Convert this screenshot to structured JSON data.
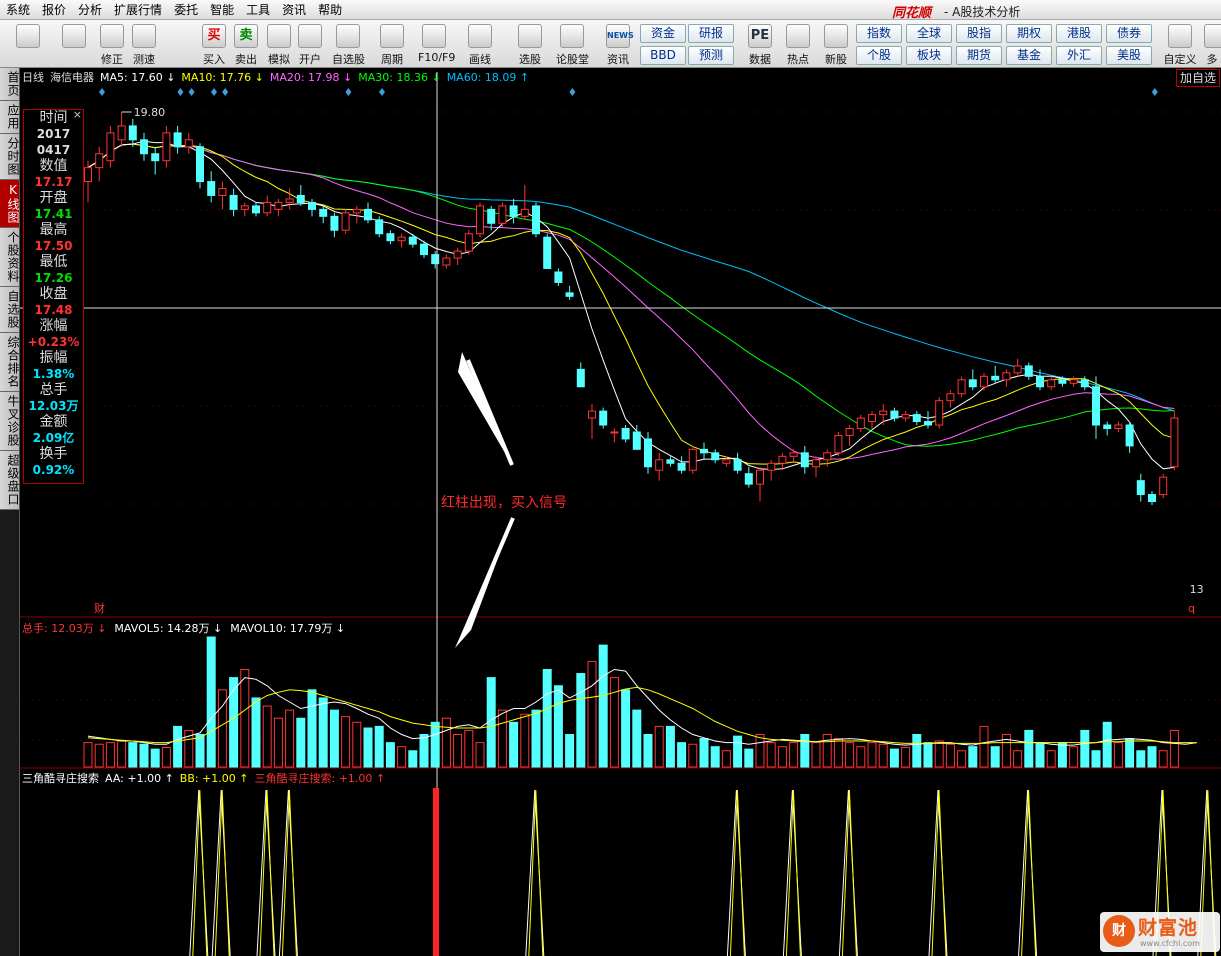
{
  "menu": [
    "系统",
    "报价",
    "分析",
    "扩展行情",
    "委托",
    "智能",
    "工具",
    "资讯",
    "帮助"
  ],
  "brand": "同花顺",
  "app_title": "- A股技术分析",
  "toolbar": {
    "items": [
      {
        "label": "",
        "icon": "color-grid-icon"
      },
      {
        "label": "",
        "icon": "back-arrow-icon"
      },
      {
        "label": "修正",
        "icon": "up-down-arrows-icon"
      },
      {
        "label": "测速",
        "icon": "clock-icon"
      },
      {
        "label": "买入",
        "icon": "buy-icon",
        "glyph": "买"
      },
      {
        "label": "卖出",
        "icon": "sell-icon",
        "glyph": "卖"
      },
      {
        "label": "模拟",
        "icon": "hammer-icon"
      },
      {
        "label": "开户",
        "icon": "lock-icon"
      },
      {
        "label": "自选股",
        "icon": "star-icon"
      },
      {
        "label": "周期",
        "icon": "period-icon"
      },
      {
        "label": "F10/F9",
        "icon": "f10-icon"
      },
      {
        "label": "画线",
        "icon": "pen-icon"
      },
      {
        "label": "选股",
        "icon": "monitor-icon"
      },
      {
        "label": "论股堂",
        "icon": "discuss-icon"
      },
      {
        "label": "资讯",
        "icon": "news-icon",
        "glyph": "NEWS"
      },
      {
        "label": "数据",
        "icon": "pe-icon",
        "glyph": "PE"
      },
      {
        "label": "热点",
        "icon": "hot-icon"
      },
      {
        "label": "新股",
        "icon": "ipo-icon"
      }
    ],
    "grid_buttons": [
      [
        "资金",
        "研报"
      ],
      [
        "BBD",
        "预测"
      ]
    ],
    "market_buttons": [
      [
        "指数",
        "全球",
        "股指",
        "期权",
        "港股",
        "债券"
      ],
      [
        "个股",
        "板块",
        "期货",
        "基金",
        "外汇",
        "美股"
      ]
    ],
    "right_label": "自定义",
    "more_label": "多"
  },
  "sidebar": [
    "首页",
    "应用",
    "分时图",
    "K线图",
    "个股资料",
    "自选股",
    "综合排名",
    "牛叉诊股",
    "超级盘口"
  ],
  "legend": {
    "period": "日线",
    "stock": "海信电器",
    "items": [
      {
        "text": "MA5: 17.60",
        "arrow": "↓",
        "color": "#ffffff"
      },
      {
        "text": "MA10: 17.76",
        "arrow": "↓",
        "color": "#ffff00"
      },
      {
        "text": "MA20: 17.98",
        "arrow": "↓",
        "color": "#ff66ff"
      },
      {
        "text": "MA30: 18.36",
        "arrow": "↓",
        "color": "#00ff00"
      },
      {
        "text": "MA60: 18.09",
        "arrow": "↑",
        "color": "#00bfff"
      }
    ]
  },
  "add_select": "加自选",
  "info": [
    {
      "k": "时间",
      "v": "2017",
      "color": "#dddddd"
    },
    {
      "k": "",
      "v": "0417",
      "color": "#dddddd"
    },
    {
      "k": "数值",
      "v": "17.17",
      "color": "#ff3333"
    },
    {
      "k": "开盘",
      "v": "17.41",
      "color": "#00dd00"
    },
    {
      "k": "最高",
      "v": "17.50",
      "color": "#ff3333"
    },
    {
      "k": "最低",
      "v": "17.26",
      "color": "#00dd00"
    },
    {
      "k": "收盘",
      "v": "17.48",
      "color": "#ff3333"
    },
    {
      "k": "涨幅",
      "v": "+0.23%",
      "color": "#ff3333"
    },
    {
      "k": "振幅",
      "v": "1.38%",
      "color": "#00e5ff"
    },
    {
      "k": "总手",
      "v": "12.03万",
      "color": "#00e5ff"
    },
    {
      "k": "金额",
      "v": "2.09亿",
      "color": "#00e5ff"
    },
    {
      "k": "换手",
      "v": "0.92%",
      "color": "#00e5ff"
    }
  ],
  "price_labels": {
    "high": "19.80",
    "low": "13",
    "q_marker": "q",
    "cai": "财"
  },
  "annotation": "红柱出现，买入信号",
  "volume_legend": [
    {
      "text": "总手: 12.03万",
      "arrow": "↓",
      "color": "#ff3333"
    },
    {
      "text": "MAVOL5: 14.28万",
      "arrow": "↓",
      "color": "#ffffff"
    },
    {
      "text": "MAVOL10: 17.79万",
      "arrow": "↓",
      "color": "#ffffff"
    }
  ],
  "indicator_legend": [
    {
      "text": "三角酷寻庄搜索",
      "arrow": "",
      "color": "#ffffff"
    },
    {
      "text": "AA: +1.00",
      "arrow": "↑",
      "color": "#ffffff"
    },
    {
      "text": "BB: +1.00",
      "arrow": "↑",
      "color": "#ffff00"
    },
    {
      "text": "三角酷寻庄搜索: +1.00",
      "arrow": "↑",
      "color": "#ff3333"
    }
  ],
  "watermark": {
    "logo": "财",
    "name": "财富池",
    "url": "www.cfchi.com"
  },
  "chart_data": {
    "type": "candlestick",
    "price_axis": [
      13,
      19.8
    ],
    "candles": [
      [
        18.8,
        19.1,
        18.5,
        19
      ],
      [
        19,
        19.3,
        18.8,
        19.2
      ],
      [
        19.1,
        19.6,
        19,
        19.5
      ],
      [
        19.4,
        19.8,
        19.3,
        19.6
      ],
      [
        19.6,
        19.7,
        19.3,
        19.4
      ],
      [
        19.4,
        19.5,
        19.1,
        19.2
      ],
      [
        19.2,
        19.3,
        18.9,
        19.1
      ],
      [
        19.1,
        19.6,
        19.0,
        19.5
      ],
      [
        19.5,
        19.6,
        19.2,
        19.3
      ],
      [
        19.3,
        19.5,
        19.2,
        19.4
      ],
      [
        19.3,
        19.35,
        18.7,
        18.8
      ],
      [
        18.8,
        18.95,
        18.5,
        18.6
      ],
      [
        18.6,
        18.8,
        18.4,
        18.7
      ],
      [
        18.6,
        18.7,
        18.3,
        18.4
      ],
      [
        18.4,
        18.5,
        18.3,
        18.45
      ],
      [
        18.45,
        18.5,
        18.3,
        18.35
      ],
      [
        18.35,
        18.6,
        18.3,
        18.5
      ],
      [
        18.4,
        18.55,
        18.3,
        18.5
      ],
      [
        18.5,
        18.7,
        18.4,
        18.55
      ],
      [
        18.6,
        18.75,
        18.45,
        18.5
      ],
      [
        18.5,
        18.55,
        18.3,
        18.4
      ],
      [
        18.4,
        18.45,
        18.2,
        18.3
      ],
      [
        18.3,
        18.35,
        18.0,
        18.1
      ],
      [
        18.1,
        18.4,
        18.05,
        18.35
      ],
      [
        18.35,
        18.45,
        18.2,
        18.4
      ],
      [
        18.4,
        18.5,
        18.2,
        18.25
      ],
      [
        18.25,
        18.3,
        18.0,
        18.05
      ],
      [
        18.05,
        18.1,
        17.9,
        17.95
      ],
      [
        17.95,
        18.05,
        17.85,
        18.0
      ],
      [
        18.0,
        18.05,
        17.85,
        17.9
      ],
      [
        17.9,
        17.95,
        17.7,
        17.75
      ],
      [
        17.75,
        17.8,
        17.55,
        17.62
      ],
      [
        17.6,
        17.75,
        17.55,
        17.7
      ],
      [
        17.7,
        17.85,
        17.6,
        17.8
      ],
      [
        17.8,
        18.1,
        17.75,
        18.05
      ],
      [
        18.05,
        18.5,
        18.0,
        18.45
      ],
      [
        18.4,
        18.45,
        18.1,
        18.2
      ],
      [
        18.2,
        18.5,
        18.15,
        18.45
      ],
      [
        18.45,
        18.55,
        18.2,
        18.3
      ],
      [
        18.3,
        18.75,
        18.25,
        18.4
      ],
      [
        18.45,
        18.5,
        18.0,
        18.05
      ],
      [
        18.0,
        18.05,
        17.6,
        17.55
      ],
      [
        17.5,
        17.55,
        17.3,
        17.35
      ],
      [
        17.2,
        17.3,
        17.1,
        17.15
      ],
      [
        16.1,
        16.2,
        15.85,
        15.85
      ],
      [
        15.4,
        15.6,
        15.1,
        15.5
      ],
      [
        15.5,
        15.55,
        15.25,
        15.3
      ],
      [
        15.2,
        15.25,
        15.05,
        15.2
      ],
      [
        15.25,
        15.3,
        15.05,
        15.1
      ],
      [
        15.2,
        15.3,
        14.95,
        14.95
      ],
      [
        15.1,
        15.2,
        14.6,
        14.7
      ],
      [
        14.65,
        14.9,
        14.5,
        14.8
      ],
      [
        14.8,
        14.85,
        14.7,
        14.75
      ],
      [
        14.75,
        14.85,
        14.6,
        14.65
      ],
      [
        14.65,
        15.0,
        14.6,
        14.95
      ],
      [
        14.95,
        15.05,
        14.8,
        14.9
      ],
      [
        14.9,
        14.95,
        14.75,
        14.8
      ],
      [
        14.75,
        14.85,
        14.7,
        14.8
      ],
      [
        14.8,
        14.9,
        14.6,
        14.65
      ],
      [
        14.6,
        14.7,
        14.4,
        14.45
      ],
      [
        14.45,
        14.7,
        14.2,
        14.65
      ],
      [
        14.65,
        14.8,
        14.5,
        14.75
      ],
      [
        14.75,
        14.9,
        14.65,
        14.85
      ],
      [
        14.85,
        14.95,
        14.75,
        14.9
      ],
      [
        14.9,
        15.0,
        14.6,
        14.7
      ],
      [
        14.7,
        14.85,
        14.55,
        14.8
      ],
      [
        14.8,
        14.95,
        14.7,
        14.9
      ],
      [
        14.9,
        15.2,
        14.85,
        15.15
      ],
      [
        15.15,
        15.3,
        15.0,
        15.25
      ],
      [
        15.25,
        15.45,
        15.2,
        15.4
      ],
      [
        15.35,
        15.5,
        15.25,
        15.45
      ],
      [
        15.45,
        15.6,
        15.3,
        15.5
      ],
      [
        15.5,
        15.55,
        15.35,
        15.4
      ],
      [
        15.4,
        15.5,
        15.35,
        15.45
      ],
      [
        15.45,
        15.5,
        15.3,
        15.35
      ],
      [
        15.35,
        15.5,
        15.25,
        15.3
      ],
      [
        15.3,
        15.7,
        15.25,
        15.65
      ],
      [
        15.65,
        15.8,
        15.55,
        15.75
      ],
      [
        15.75,
        16.0,
        15.7,
        15.95
      ],
      [
        15.95,
        16.1,
        15.8,
        15.85
      ],
      [
        15.85,
        16.05,
        15.8,
        16.0
      ],
      [
        16.0,
        16.15,
        15.9,
        15.95
      ],
      [
        15.95,
        16.1,
        15.85,
        16.05
      ],
      [
        16.05,
        16.25,
        16.0,
        16.15
      ],
      [
        16.15,
        16.2,
        15.95,
        16.0
      ],
      [
        16.0,
        16.1,
        15.8,
        15.85
      ],
      [
        15.85,
        16.0,
        15.8,
        15.95
      ],
      [
        15.95,
        16.0,
        15.85,
        15.9
      ],
      [
        15.9,
        16.0,
        15.85,
        15.95
      ],
      [
        15.95,
        16.0,
        15.8,
        15.85
      ],
      [
        15.85,
        16.0,
        15.1,
        15.3
      ],
      [
        15.3,
        15.35,
        15.15,
        15.25
      ],
      [
        15.25,
        15.35,
        15.2,
        15.3
      ],
      [
        15.3,
        15.35,
        14.9,
        15.0
      ],
      [
        14.5,
        14.6,
        14.2,
        14.3
      ],
      [
        14.3,
        14.35,
        14.15,
        14.2
      ],
      [
        14.3,
        14.6,
        14.25,
        14.55
      ],
      [
        14.7,
        15.5,
        14.65,
        15.4
      ]
    ],
    "volume_axis": [
      0,
      160
    ],
    "volumes": [
      30,
      28,
      30,
      32,
      30,
      28,
      22,
      24,
      50,
      45,
      40,
      160,
      95,
      110,
      120,
      85,
      75,
      60,
      70,
      60,
      95,
      85,
      70,
      62,
      55,
      48,
      50,
      30,
      25,
      20,
      40,
      55,
      60,
      40,
      45,
      30,
      110,
      70,
      55,
      65,
      70,
      120,
      100,
      40,
      115,
      130,
      150,
      110,
      95,
      70,
      40,
      50,
      50,
      30,
      28,
      35,
      25,
      20,
      38,
      22,
      40,
      30,
      25,
      30,
      40,
      30,
      40,
      35,
      30,
      25,
      30,
      28,
      22,
      24,
      40,
      30,
      32,
      28,
      20,
      25,
      50,
      25,
      40,
      20,
      45,
      30,
      20,
      30,
      25,
      45,
      20,
      55,
      30,
      35,
      20,
      25,
      20,
      45,
      15,
      40
    ],
    "volume_ma5": [
      38,
      36,
      34,
      32,
      32,
      30,
      28,
      28,
      34,
      38,
      42,
      60,
      75,
      95,
      110,
      108,
      100,
      88,
      80,
      72,
      75,
      78,
      80,
      78,
      72,
      65,
      60,
      48,
      40,
      35,
      36,
      40,
      45,
      50,
      52,
      48,
      58,
      66,
      72,
      72,
      80,
      90,
      95,
      85,
      92,
      100,
      112,
      120,
      118,
      100,
      85,
      70,
      58,
      48,
      40,
      36,
      32,
      30,
      30,
      28,
      30,
      32,
      34,
      33,
      32,
      31,
      33,
      34,
      35,
      34,
      32,
      30,
      28,
      27,
      28,
      29,
      30,
      30,
      28,
      27,
      30,
      32,
      34,
      32,
      30,
      30,
      28,
      27,
      27,
      29,
      30,
      33,
      34,
      35,
      34,
      33,
      30,
      29,
      28,
      30
    ],
    "volume_ma10": [
      36,
      35,
      34,
      33,
      32,
      31,
      30,
      30,
      32,
      34,
      36,
      44,
      52,
      60,
      70,
      80,
      88,
      92,
      95,
      94,
      92,
      88,
      84,
      80,
      76,
      72,
      68,
      62,
      58,
      54,
      52,
      50,
      49,
      48,
      48,
      48,
      50,
      54,
      58,
      62,
      66,
      72,
      78,
      82,
      84,
      86,
      88,
      92,
      96,
      98,
      95,
      90,
      84,
      78,
      72,
      64,
      56,
      50,
      44,
      40,
      36,
      34,
      33,
      32,
      31,
      31,
      31,
      32,
      32,
      32,
      32,
      31,
      30,
      29,
      29,
      29,
      29,
      29,
      29,
      29,
      29,
      30,
      30,
      30,
      30,
      30,
      30,
      30,
      30,
      30,
      30,
      31,
      31,
      32,
      32,
      32,
      31,
      30,
      30,
      30
    ],
    "signal_positions": [
      9,
      11,
      15,
      17,
      39,
      57,
      62,
      67,
      75,
      83,
      95,
      99
    ]
  }
}
